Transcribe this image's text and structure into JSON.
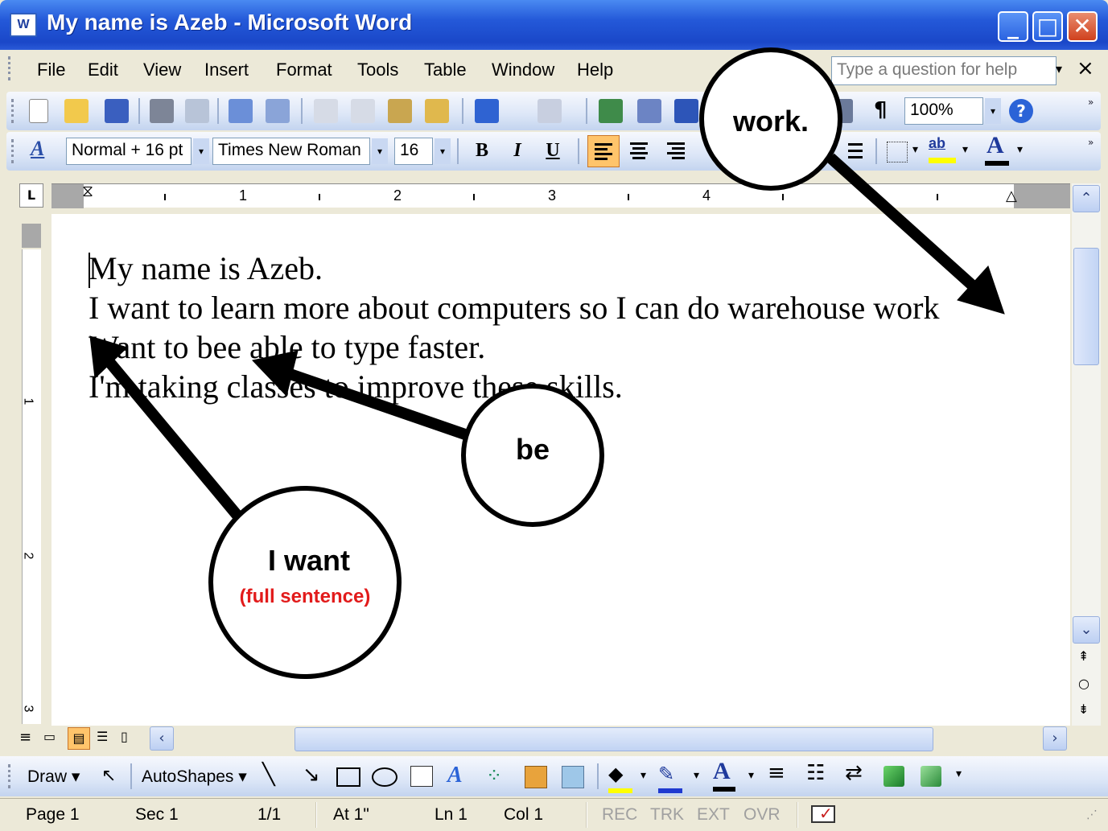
{
  "window": {
    "title": "My name is Azeb - Microsoft Word",
    "app_icon": "W",
    "controls": [
      "minimize",
      "maximize",
      "close"
    ]
  },
  "menu": {
    "items": [
      "File",
      "Edit",
      "View",
      "Insert",
      "Format",
      "Tools",
      "Table",
      "Window",
      "Help"
    ],
    "help_placeholder": "Type a question for help",
    "close_glyph": "×"
  },
  "standard_toolbar": {
    "zoom": "100%",
    "pilcrow": "¶"
  },
  "formatting_toolbar": {
    "style": "Normal + 16 pt",
    "font": "Times New Roman",
    "size": "16",
    "bold": "B",
    "italic": "I",
    "underline": "U",
    "highlight_label": "ab",
    "font_color_label": "A"
  },
  "ruler": {
    "numbers": [
      "1",
      "2",
      "3",
      "4"
    ],
    "vertical_numbers": [
      "1",
      "2",
      "3"
    ]
  },
  "document": {
    "lines": [
      "My name is Azeb.",
      "I want to learn more about computers so I can do warehouse work",
      "Want to bee able to type faster.",
      "I'm taking classes to improve these skills."
    ]
  },
  "annotations": {
    "work": "work.",
    "be": "be",
    "i_want": "I want",
    "full_sentence": "(full sentence)",
    "accent_red": "#e21b1b"
  },
  "draw_toolbar": {
    "draw": "Draw",
    "autoshapes": "AutoShapes"
  },
  "status": {
    "page": "Page  1",
    "sec": "Sec  1",
    "pages": "1/1",
    "at": "At  1\"",
    "ln": "Ln  1",
    "col": "Col  1",
    "rec": "REC",
    "trk": "TRK",
    "ext": "EXT",
    "ovr": "OVR"
  }
}
